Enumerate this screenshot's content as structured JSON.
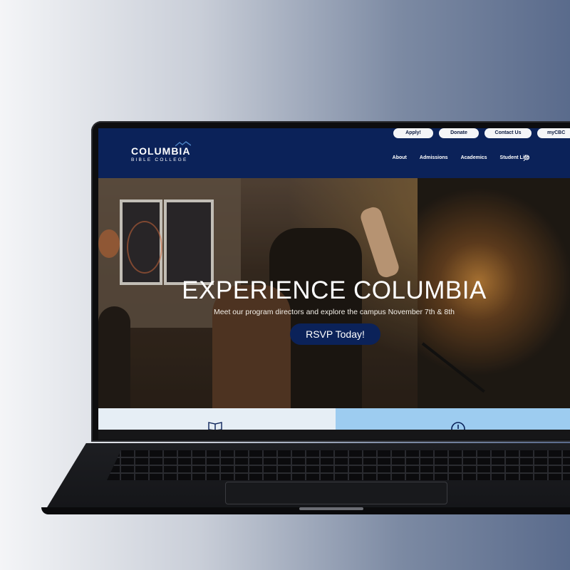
{
  "utility_nav": {
    "apply": "Apply!",
    "donate": "Donate",
    "contact": "Contact Us",
    "mycbc": "myCBC"
  },
  "logo": {
    "name": "COLUMBIA",
    "subtitle": "BIBLE COLLEGE"
  },
  "main_nav": {
    "items": [
      {
        "label": "About"
      },
      {
        "label": "Admissions"
      },
      {
        "label": "Academics"
      },
      {
        "label": "Student Life"
      }
    ],
    "search_icon": "search-icon"
  },
  "hero": {
    "title": "EXPERIENCE COLUMBIA",
    "subtitle": "Meet our program directors and explore the campus November 7th & 8th",
    "cta": "RSVP Today!"
  },
  "icons": {
    "left_strip": "book-icon",
    "right_strip": "compass-icon"
  },
  "colors": {
    "brand_navy": "#0b2259",
    "strip_light": "#e6eef5",
    "strip_blue": "#9dccf0"
  }
}
